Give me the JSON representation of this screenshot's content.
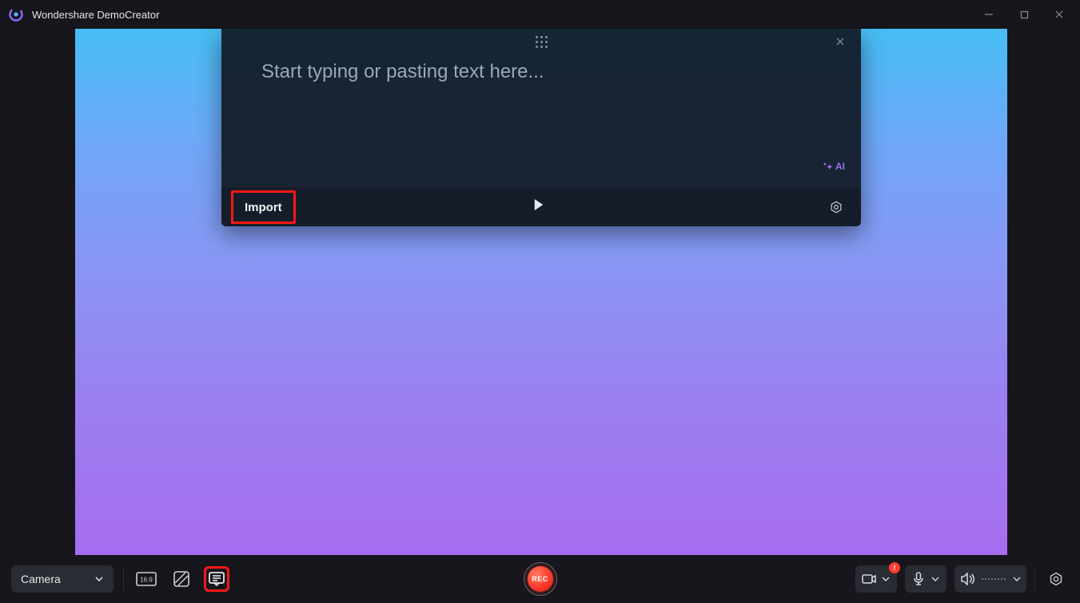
{
  "app": {
    "title": "Wondershare DemoCreator"
  },
  "teleprompter": {
    "placeholder": "Start typing or pasting text here...",
    "import_label": "Import",
    "ai_label": "AI"
  },
  "bottombar": {
    "source_label": "Camera",
    "record_label": "REC",
    "alert_text": "!"
  }
}
